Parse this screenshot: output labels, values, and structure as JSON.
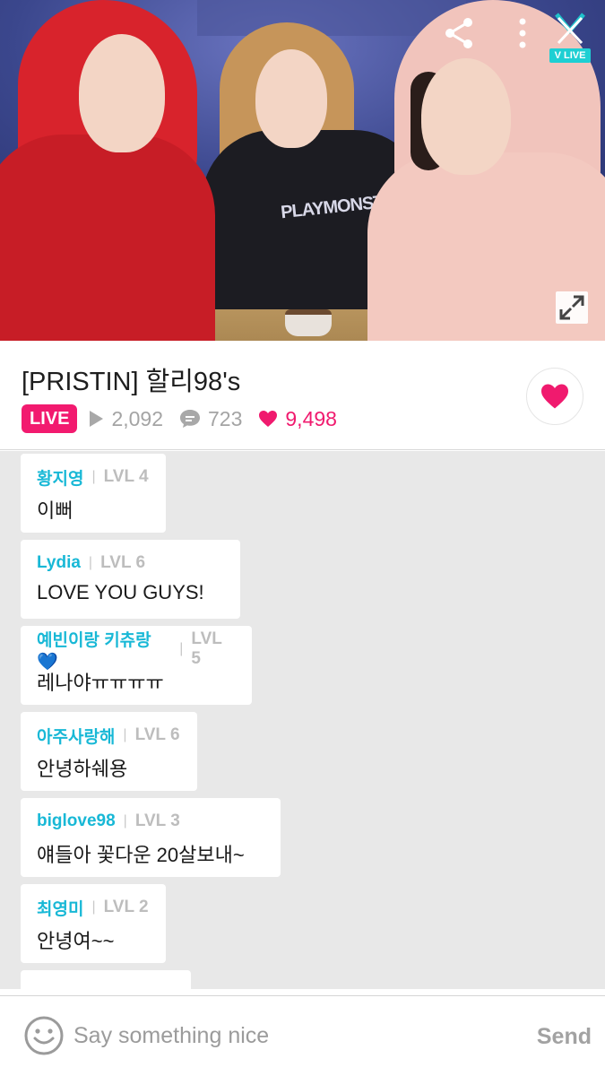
{
  "video": {
    "badge_label": "V LIVE",
    "shirt_text": "PLAYMONSTER",
    "icons": [
      "share-icon",
      "more-vertical-icon",
      "close-icon",
      "expand-icon"
    ]
  },
  "broadcast": {
    "title": "[PRISTIN] 할리98's",
    "live_label": "LIVE",
    "views": "2,092",
    "comments": "723",
    "hearts": "9,498",
    "colors": {
      "live": "#f21a6f",
      "heart": "#f01a6e",
      "username": "#18b8d6"
    }
  },
  "chat": {
    "messages": [
      {
        "user": "황지영",
        "level": "LVL 4",
        "text": "이뻐"
      },
      {
        "user": "Lydia",
        "level": "LVL 6",
        "text": "LOVE YOU GUYS!"
      },
      {
        "user": "예빈이랑 키츄랑💙",
        "level": "LVL 5",
        "text": "레나야ㅠㅠㅠㅠ"
      },
      {
        "user": "아주사랑해",
        "level": "LVL 6",
        "text": "안녕하쉐용"
      },
      {
        "user": "biglove98",
        "level": "LVL 3",
        "text": "얘들아 꽃다운 20살보내~"
      },
      {
        "user": "최영미",
        "level": "LVL 2",
        "text": "안녕여~~"
      },
      {
        "user": "",
        "level": "",
        "text": ""
      }
    ]
  },
  "input": {
    "placeholder": "Say something nice",
    "send_label": "Send"
  }
}
